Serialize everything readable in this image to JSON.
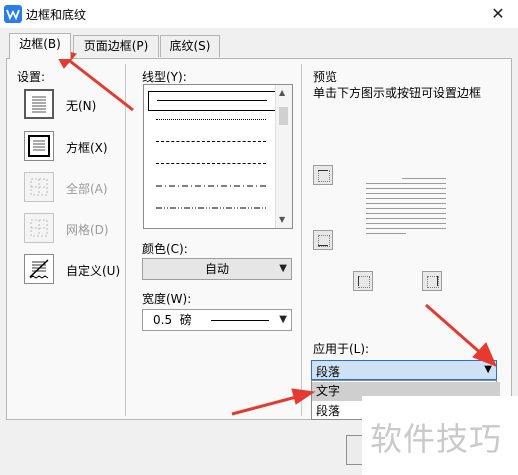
{
  "window": {
    "title": "边框和底纹",
    "close_glyph": "✕",
    "app_icon": "wps-icon"
  },
  "tabs": [
    {
      "label": "边框(B)",
      "active": true
    },
    {
      "label": "页面边框(P)",
      "active": false
    },
    {
      "label": "底纹(S)",
      "active": false
    }
  ],
  "settings": {
    "label": "设置:",
    "options": [
      {
        "label": "无(N)",
        "enabled": true,
        "selected": true
      },
      {
        "label": "方框(X)",
        "enabled": true,
        "selected": false
      },
      {
        "label": "全部(A)",
        "enabled": false,
        "selected": false
      },
      {
        "label": "网格(D)",
        "enabled": false,
        "selected": false
      },
      {
        "label": "自定义(U)",
        "enabled": true,
        "selected": false
      }
    ]
  },
  "line_style": {
    "label": "线型(Y):",
    "styles": [
      "solid",
      "dotted",
      "dashed",
      "dash-dot",
      "dash-dot-dot"
    ],
    "selected_index": 0
  },
  "color": {
    "label": "颜色(C):",
    "value": "自动"
  },
  "width": {
    "label": "宽度(W):",
    "value": "0.5  磅"
  },
  "preview": {
    "label": "预览",
    "hint": "单击下方图示或按钮可设置边框"
  },
  "apply_to": {
    "label": "应用于(L):",
    "value": "段落",
    "options": [
      {
        "label": "文字",
        "hovered": true
      },
      {
        "label": "段落",
        "hovered": false
      }
    ]
  },
  "watermark": "软件技巧",
  "colors": {
    "annotation_arrow": "#e53a2f",
    "accent": "#2b7ce9"
  }
}
